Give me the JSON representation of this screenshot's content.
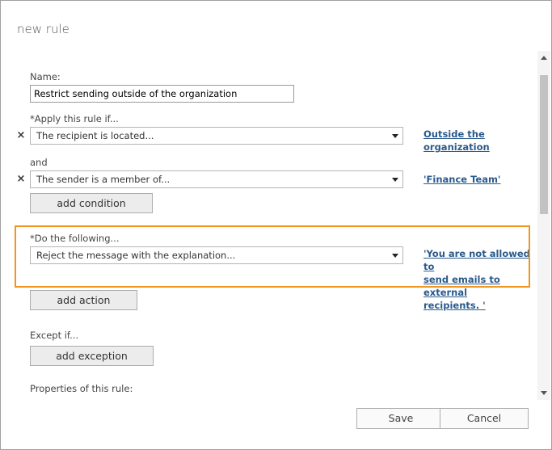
{
  "dialog": {
    "title": "new rule"
  },
  "form": {
    "name_label": "Name:",
    "name_value": "Restrict sending outside of the organization",
    "apply_label": "*Apply this rule if...",
    "condition1": {
      "select_value": "The recipient is located...",
      "link_line1": "Outside the",
      "link_line2": "organization"
    },
    "and_label": "and",
    "condition2": {
      "select_value": "The sender is a member of...",
      "link_text": "'Finance Team'"
    },
    "add_condition_label": "add condition",
    "do_label": "*Do the following...",
    "action": {
      "select_value": "Reject the message with the explanation...",
      "link_line1": "'You are not allowed to",
      "link_line2": "send emails to external",
      "link_line3": "recipients. '"
    },
    "add_action_label": "add action",
    "except_label": "Except if...",
    "add_exception_label": "add exception",
    "properties_label": "Properties of this rule:"
  },
  "footer": {
    "save_label": "Save",
    "cancel_label": "Cancel"
  },
  "icons": {
    "remove": "close-icon",
    "dropdown": "chevron-down-icon"
  },
  "colors": {
    "highlight": "#f0961e",
    "link": "#2a5a8c"
  }
}
